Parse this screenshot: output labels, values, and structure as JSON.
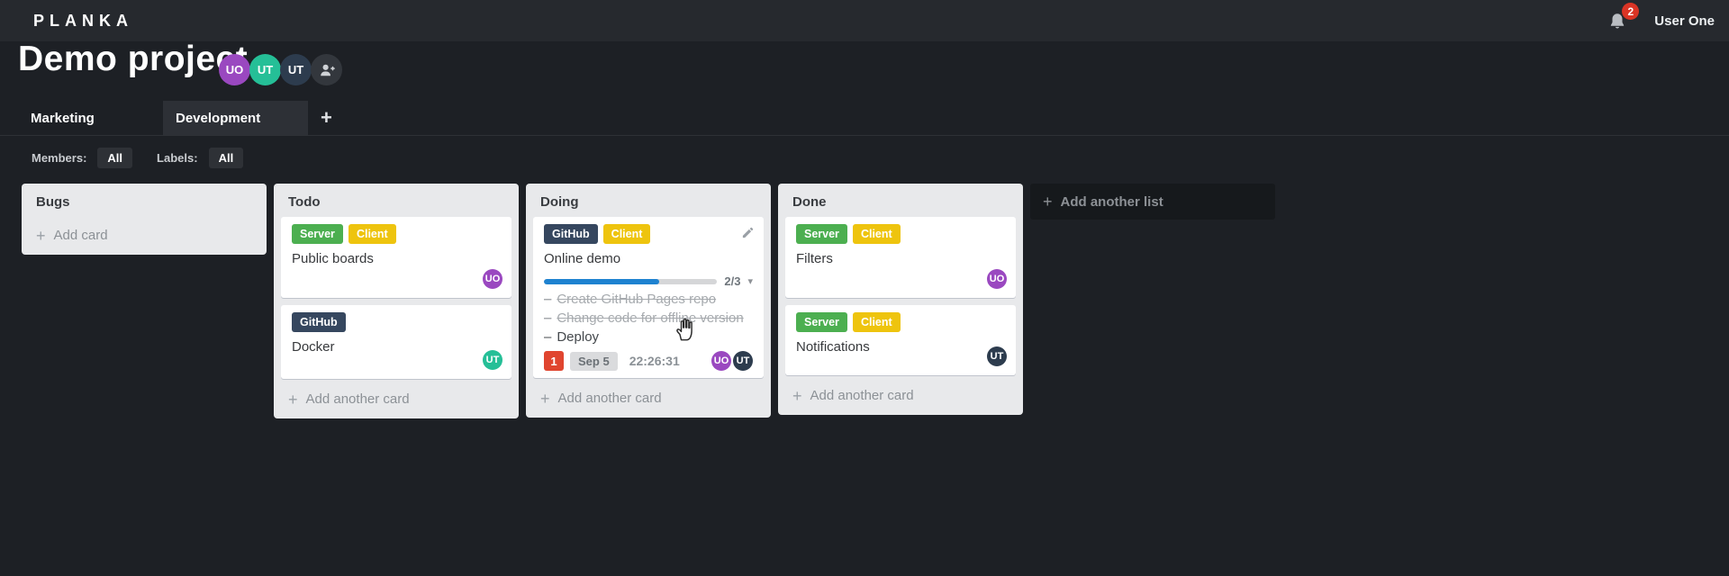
{
  "topbar": {
    "logo": "PLANKA",
    "notifications_count": "2",
    "user_name": "User One"
  },
  "project": {
    "title": "Demo project",
    "members": [
      {
        "initials": "UO",
        "color": "#9a48c0"
      },
      {
        "initials": "UT",
        "color": "#25bf97"
      },
      {
        "initials": "UT",
        "color": "#2d3c4e"
      }
    ]
  },
  "tabs": {
    "items": [
      {
        "label": "Marketing",
        "active": false
      },
      {
        "label": "Development",
        "active": true
      }
    ]
  },
  "filters": {
    "members_label": "Members:",
    "members_value": "All",
    "labels_label": "Labels:",
    "labels_value": "All"
  },
  "board": {
    "add_list_label": "Add another list",
    "lists": [
      {
        "title": "Bugs",
        "footer": "Add card",
        "cards": []
      },
      {
        "title": "Todo",
        "footer": "Add another card",
        "cards": [
          {
            "title": "Public boards",
            "labels": [
              {
                "text": "Server",
                "color": "#4caf50"
              },
              {
                "text": "Client",
                "color": "#eec40e"
              }
            ],
            "member": {
              "initials": "UO",
              "color": "#9a48c0"
            }
          },
          {
            "title": "Docker",
            "labels": [
              {
                "text": "GitHub",
                "color": "#36475f"
              }
            ],
            "member": {
              "initials": "UT",
              "color": "#25bf97"
            }
          }
        ]
      },
      {
        "title": "Doing",
        "footer": "Add another card",
        "cards": [
          {
            "title": "Online demo",
            "labels": [
              {
                "text": "GitHub",
                "color": "#36475f"
              },
              {
                "text": "Client",
                "color": "#eec40e"
              }
            ],
            "progress": {
              "display": "2/3",
              "percent": 66.5,
              "bar_color": "#1e82d0"
            },
            "tasks": [
              {
                "text": "Create GitHub Pages repo",
                "done": true
              },
              {
                "text": "Change code for offline version",
                "done": true
              },
              {
                "text": "Deploy",
                "done": false
              }
            ],
            "notifications_count": "1",
            "due_date": "Sep 5",
            "timer": "22:26:31",
            "members": [
              {
                "initials": "UO",
                "color": "#9a48c0"
              },
              {
                "initials": "UT",
                "color": "#2d3c4e"
              }
            ]
          }
        ]
      },
      {
        "title": "Done",
        "footer": "Add another card",
        "cards": [
          {
            "title": "Filters",
            "labels": [
              {
                "text": "Server",
                "color": "#4caf50"
              },
              {
                "text": "Client",
                "color": "#eec40e"
              }
            ],
            "member": {
              "initials": "UO",
              "color": "#9a48c0"
            }
          },
          {
            "title": "Notifications",
            "labels": [
              {
                "text": "Server",
                "color": "#4caf50"
              },
              {
                "text": "Client",
                "color": "#eec40e"
              }
            ],
            "member": {
              "initials": "UT",
              "color": "#2d3c4e"
            }
          }
        ]
      }
    ]
  },
  "icons": {
    "add": "+",
    "caret_down": "▾",
    "task_dash": "–"
  }
}
